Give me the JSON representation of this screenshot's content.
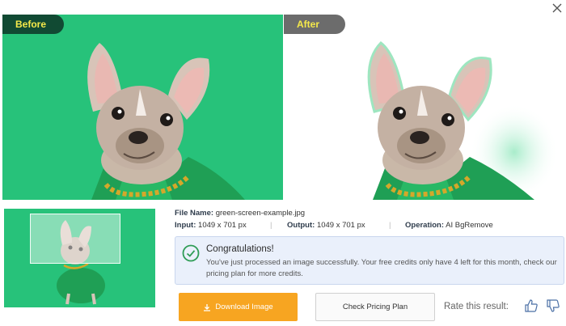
{
  "labels": {
    "before": "Before",
    "after": "After"
  },
  "file": {
    "name_label": "File Name:",
    "name_value": "green-screen-example.jpg",
    "input_label": "Input:",
    "input_value": "1049 x 701 px",
    "output_label": "Output:",
    "output_value": "1049 x 701 px",
    "operation_label": "Operation:",
    "operation_value": "AI BgRemove"
  },
  "notice": {
    "title": "Congratulations!",
    "body": "You've just processed an image successfully. Your free credits only have 4 left for this month, check our pricing plan for more credits."
  },
  "actions": {
    "download": "Download Image",
    "pricing": "Check Pricing Plan",
    "rate": "Rate this result:"
  },
  "icons": {
    "close": "close-icon",
    "check": "check-circle-icon",
    "download": "download-icon",
    "like": "thumbs-up-icon",
    "dislike": "thumbs-down-icon"
  },
  "colors": {
    "green_screen": "#27c27a",
    "before_tag": "#114a33",
    "after_tag": "#6c6c6c",
    "tag_text": "#f5e94a",
    "download_button": "#f7a521",
    "notice_bg": "#eaf0fb",
    "check_green": "#2e9c55"
  }
}
